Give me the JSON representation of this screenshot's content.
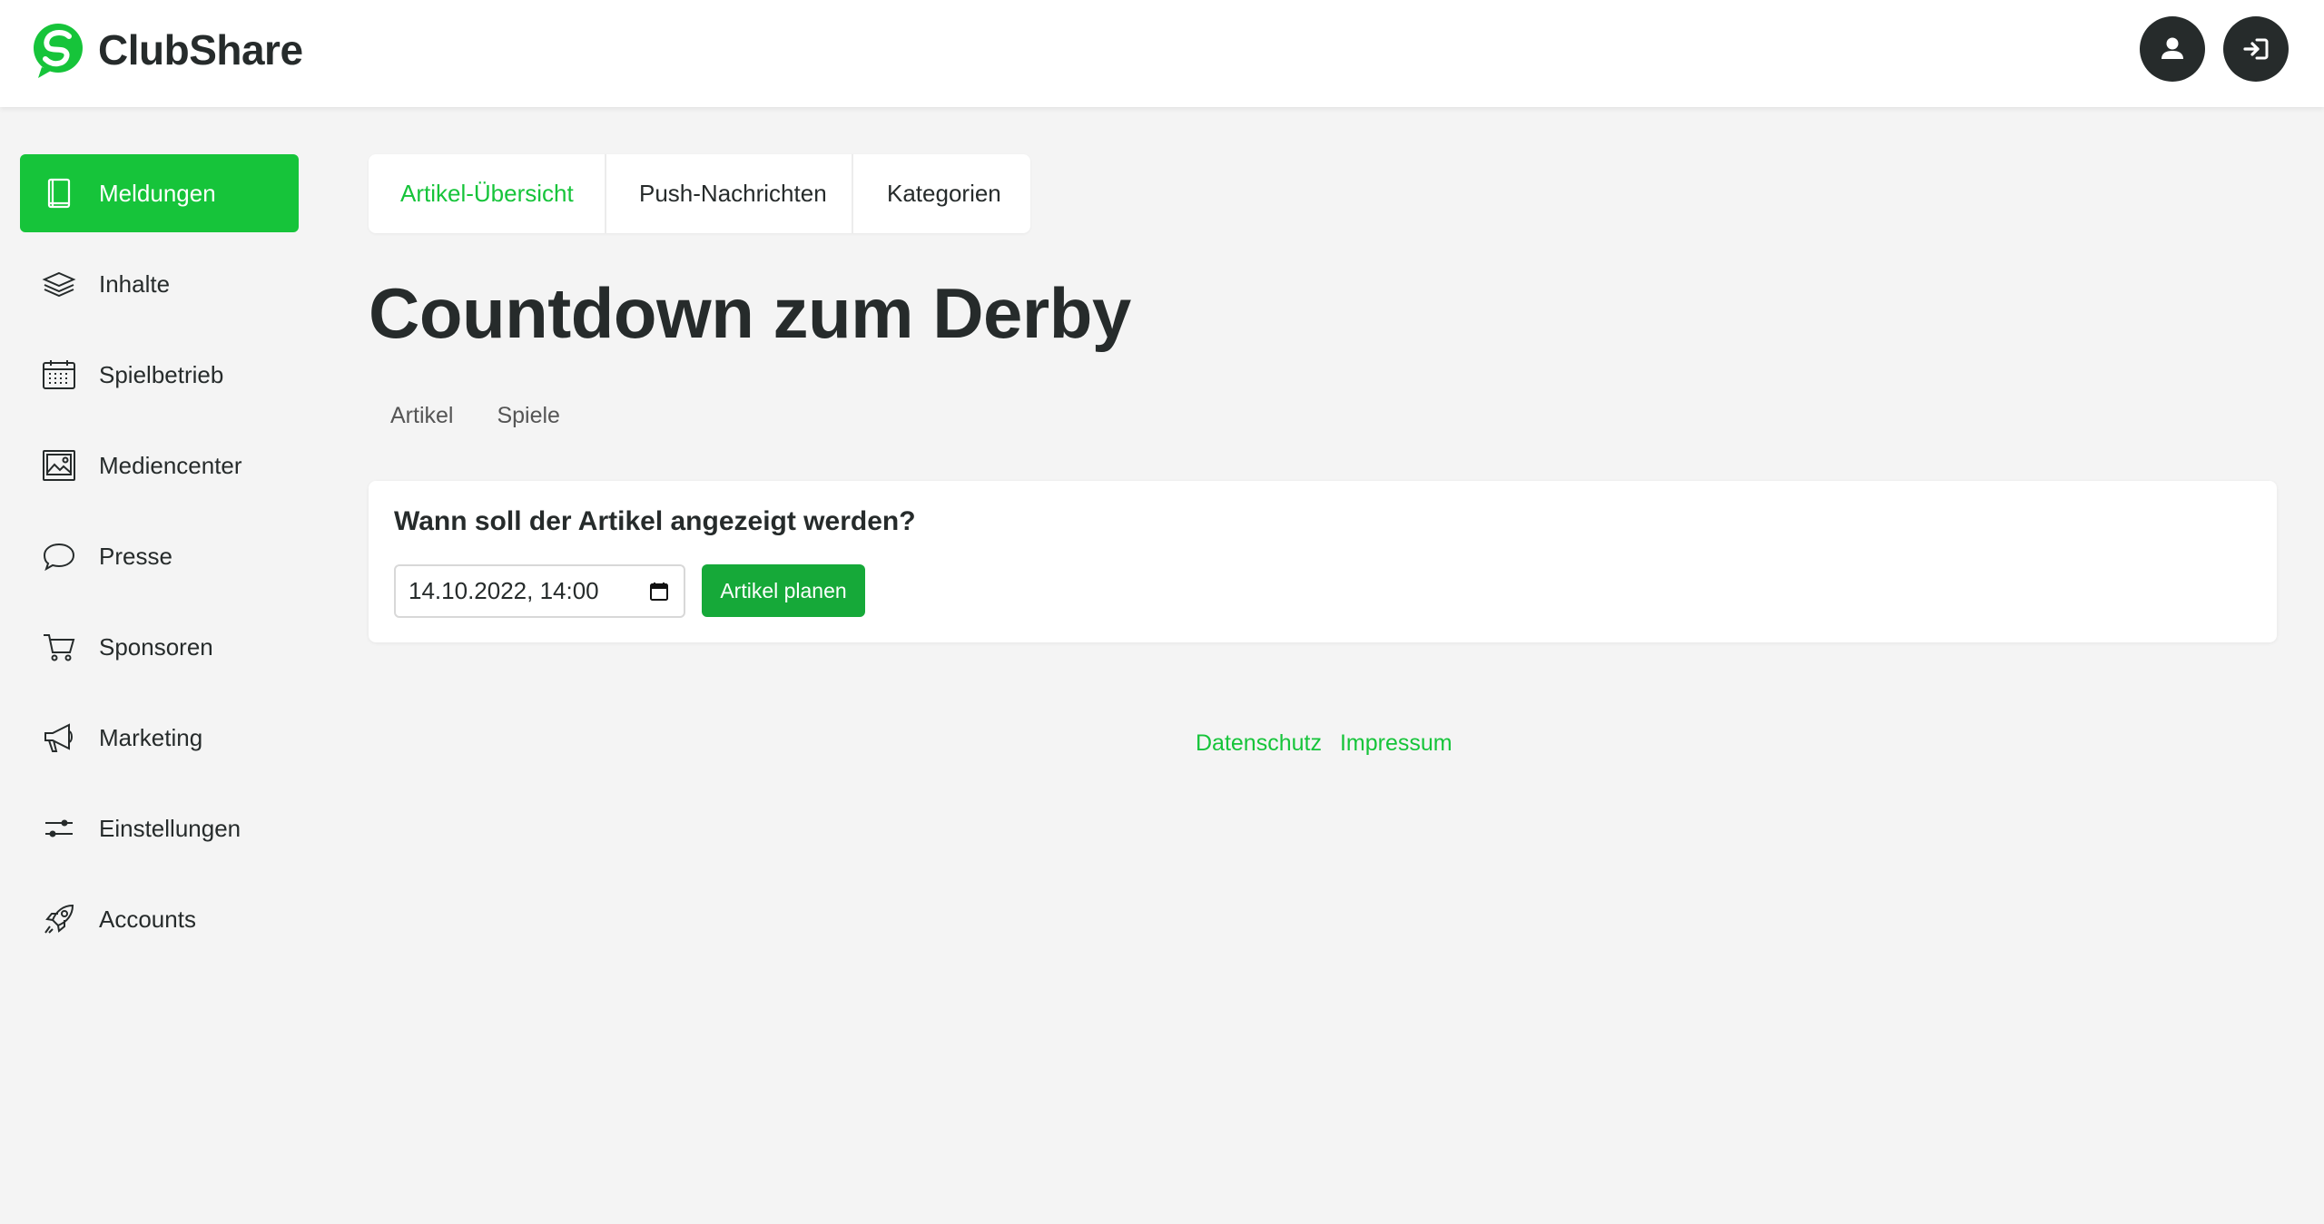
{
  "app": {
    "name": "ClubShare"
  },
  "colors": {
    "accent": "#16c43a",
    "dark": "#262b2b",
    "button": "#16a939",
    "background": "#f4f4f4"
  },
  "header": {
    "user_button_icon": "user-icon",
    "logout_button_icon": "logout-icon"
  },
  "sidebar": {
    "items": [
      {
        "label": "Meldungen",
        "icon": "book-icon",
        "active": true
      },
      {
        "label": "Inhalte",
        "icon": "layers-icon"
      },
      {
        "label": "Spielbetrieb",
        "icon": "calendar-icon"
      },
      {
        "label": "Mediencenter",
        "icon": "image-icon"
      },
      {
        "label": "Presse",
        "icon": "speech-bubble-icon"
      },
      {
        "label": "Sponsoren",
        "icon": "cart-icon"
      },
      {
        "label": "Marketing",
        "icon": "megaphone-icon"
      },
      {
        "label": "Einstellungen",
        "icon": "sliders-icon"
      },
      {
        "label": "Accounts",
        "icon": "rocket-icon"
      }
    ]
  },
  "tabs": [
    {
      "label": "Artikel-Übersicht",
      "active": true
    },
    {
      "label": "Push-Nachrichten"
    },
    {
      "label": "Kategorien"
    }
  ],
  "page": {
    "title": "Countdown zum Derby"
  },
  "subtabs": [
    {
      "label": "Artikel"
    },
    {
      "label": "Spiele"
    }
  ],
  "schedule": {
    "question": "Wann soll der Artikel angezeigt werden?",
    "datetime_value": "14.10.2022, 14:00",
    "button_label": "Artikel planen"
  },
  "footer": {
    "links": [
      "Datenschutz",
      "Impressum"
    ]
  }
}
